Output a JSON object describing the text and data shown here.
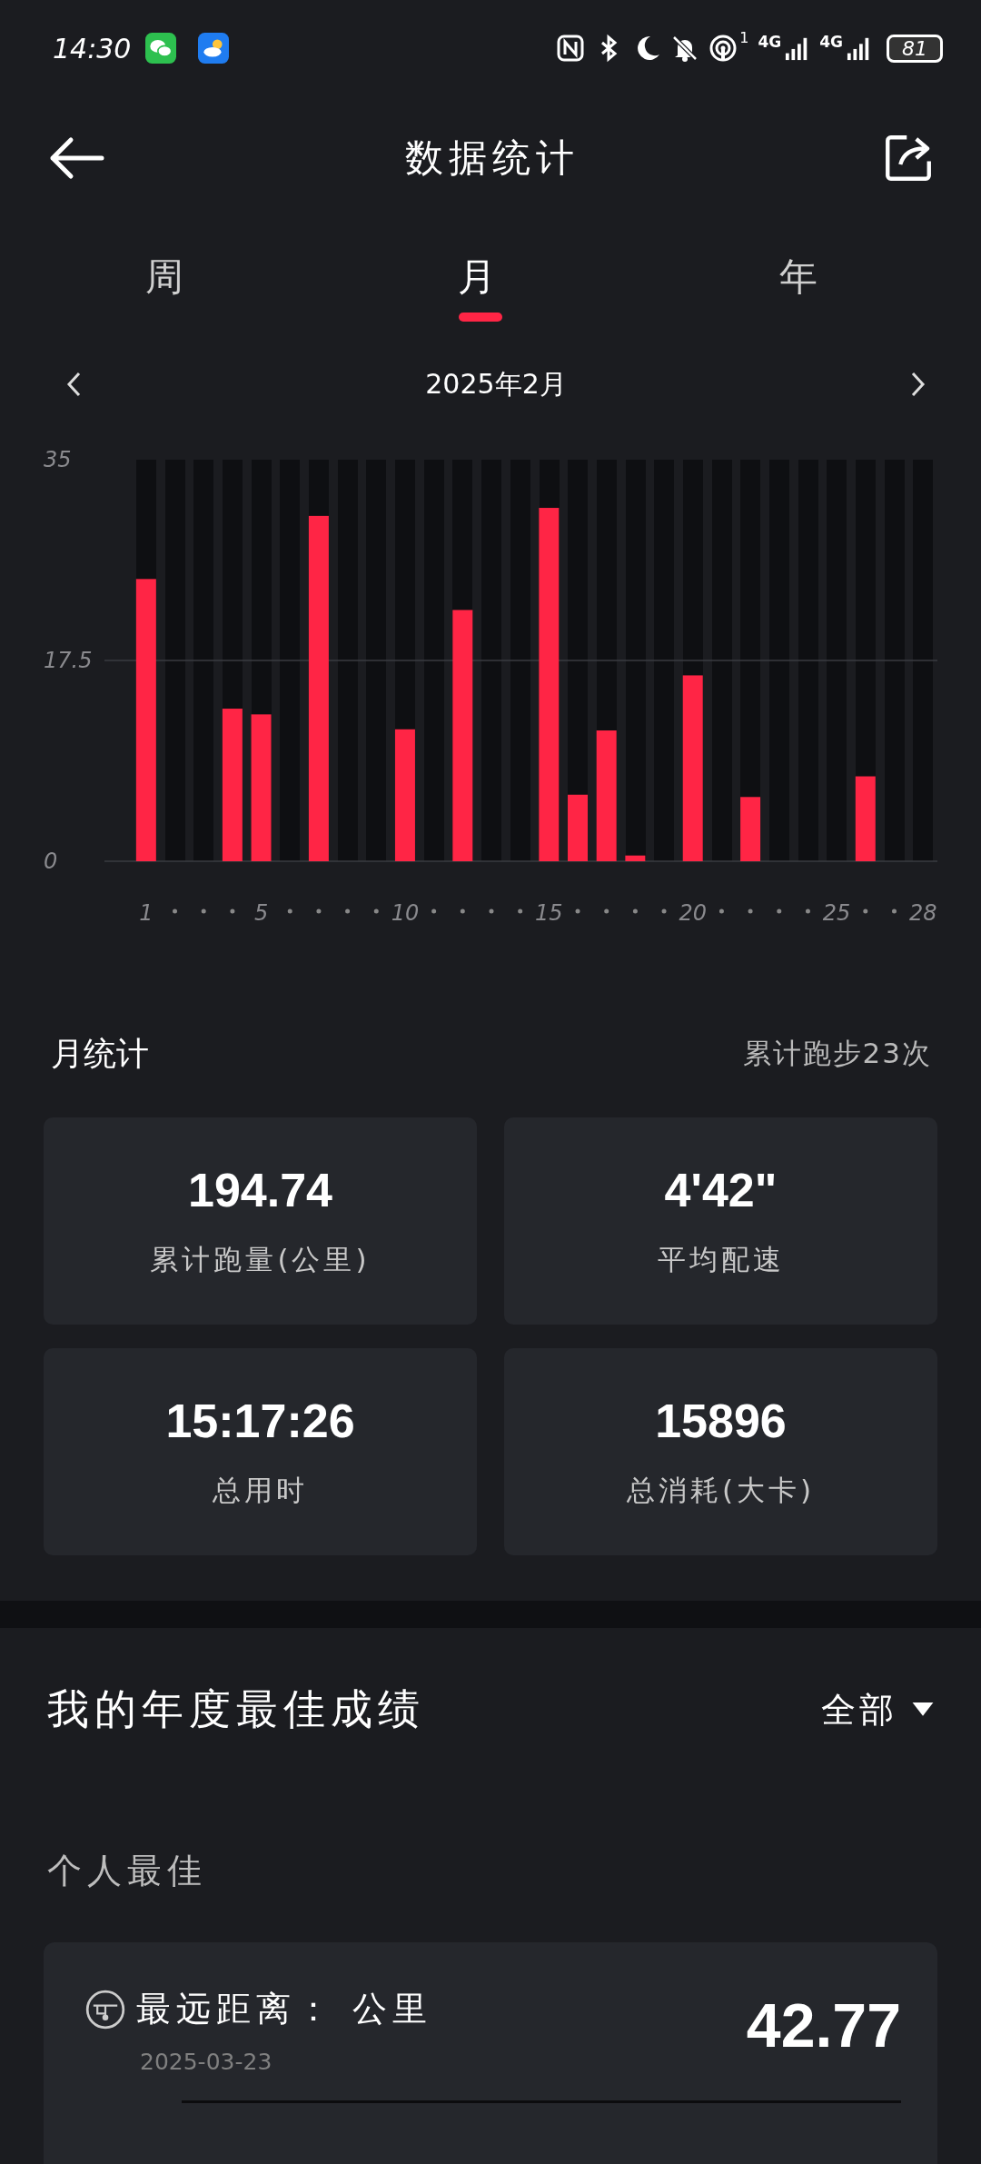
{
  "status_bar": {
    "time": "14:30",
    "hotspot_count": "1",
    "network_1": "4G",
    "network_2": "4G",
    "battery": "81"
  },
  "header": {
    "title": "数据统计"
  },
  "tabs": [
    {
      "label": "周",
      "selected": false
    },
    {
      "label": "月",
      "selected": true
    },
    {
      "label": "年",
      "selected": false
    }
  ],
  "period": {
    "label": "2025年2月"
  },
  "chart": {
    "chart_data": {
      "type": "bar",
      "x": [
        1,
        2,
        3,
        4,
        5,
        6,
        7,
        8,
        9,
        10,
        11,
        12,
        13,
        14,
        15,
        16,
        17,
        18,
        19,
        20,
        21,
        22,
        23,
        24,
        25,
        26,
        27,
        28
      ],
      "series": [
        {
          "color": "#ff2545",
          "values": [
            24.6,
            0,
            0,
            13.3,
            12.8,
            0,
            30.1,
            0,
            0,
            11.5,
            0,
            21.9,
            0,
            0,
            30.8,
            5.8,
            11.4,
            0.5,
            0,
            16.2,
            0,
            5.6,
            0,
            0,
            0,
            7.4,
            0,
            0
          ]
        }
      ],
      "xlim": [
        0.5,
        28.5
      ],
      "ylim": [
        0,
        35
      ],
      "yticks": [
        0,
        17.5,
        35
      ],
      "xticks": [
        1,
        5,
        10,
        15,
        20,
        25,
        28
      ]
    }
  },
  "month_stats": {
    "title": "月统计",
    "summary": "累计跑步23次",
    "cards": [
      {
        "value": "194.74",
        "label": "累计跑量(公里)"
      },
      {
        "value": "4'42\"",
        "label": "平均配速"
      },
      {
        "value": "15:17:26",
        "label": "总用时"
      },
      {
        "value": "15896",
        "label": "总消耗(大卡)"
      }
    ]
  },
  "best": {
    "title": "我的年度最佳成绩",
    "filter": "全部",
    "section": "个人最佳",
    "records": [
      {
        "title": "最远距离： 公里",
        "date": "2025-03-23",
        "value": "42.77"
      }
    ]
  }
}
